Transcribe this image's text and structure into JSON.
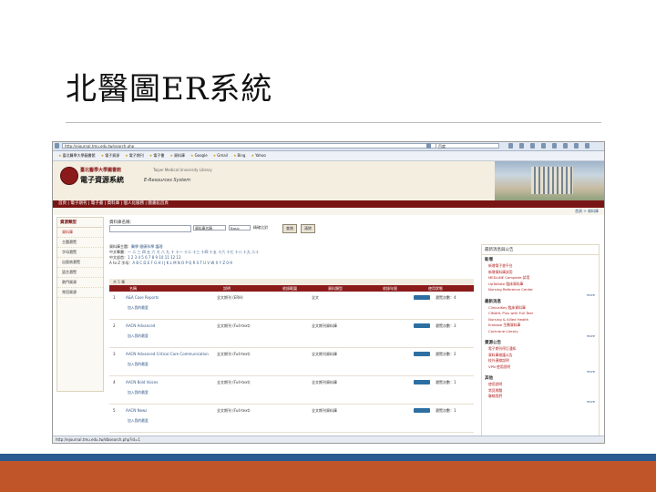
{
  "slide": {
    "title": "北醫圖ER系統"
  },
  "browser": {
    "url": "http://ejournal.tmu.edu.tw/search.php",
    "search_placeholder": "百度"
  },
  "favorites": [
    "臺北醫學大學圖書館",
    "電子資源",
    "電子期刊",
    "電子書",
    "資料庫",
    "Google",
    "Gmail",
    "Bing",
    "Yahoo"
  ],
  "header": {
    "university": "臺北醫學大學圖書館",
    "university_en": "Taipei Medical University Library",
    "system_name": "電子資源系統",
    "system_en": "E-Resources System",
    "toplinks": "首頁 | 電子資源系統 | 圖書館"
  },
  "nav": {
    "text": "首頁 | 電子期刊 | 電子書 | 資料庫 | 個人化服務 | 圖書館首頁"
  },
  "breadcrumb": "首頁 > 資料庫",
  "sidebar": {
    "heading": "資源類型",
    "items": [
      "資料庫",
      "主題瀏覽",
      "字母瀏覽",
      "出版商瀏覽",
      "語言瀏覽",
      "熱門資源",
      "常用資源"
    ]
  },
  "search": {
    "label": "資料庫名稱：",
    "field_select": "資料庫名稱",
    "type_select": "Basic",
    "option_label": "精確比對",
    "search_button": "查詢",
    "reset_button": "清除"
  },
  "filters": {
    "line1_label": "資料庫主題：",
    "line1_value": "醫學 健康科學 護理",
    "line2_label": "中文筆畫：",
    "line2_value": "一 二 三 四 五 六 七 八 九 十 十一 十二 十三 十四 十五 十六 十七 十八 十九 二十",
    "line3_label": "中文部首：",
    "line3_value": "1 2 3 4 5 6 7 8 9 10 11 12 13",
    "line4_label": "A to Z 字母：",
    "line4_value": "A B C D E F G H I J K L M N O P Q R S T U V W X Y Z 0-9"
  },
  "table": {
    "toolbar": "共 5 筆",
    "headers": [
      "名稱",
      "說明",
      "收錄範圍",
      "資料類型",
      "收錄年限",
      "使用狀態"
    ],
    "rows": [
      {
        "num": "1",
        "title": "A&A Case Reports",
        "desc": "全文期刊 (ERH)",
        "type": "全文",
        "stats": "瀏覽次數：4",
        "tag": "加入我的最愛"
      },
      {
        "num": "2",
        "title": "AACN Advanced",
        "desc": "全文期刊 (Full-text)",
        "type": "全文期刊資料庫",
        "stats": "瀏覽次數：3",
        "tag": "加入我的最愛"
      },
      {
        "num": "3",
        "title": "AACN Advanced Critical Care Communication",
        "desc": "全文期刊 (Full-text)",
        "type": "全文期刊資料庫",
        "stats": "瀏覽次數：2",
        "tag": "加入我的最愛"
      },
      {
        "num": "4",
        "title": "AACN Bold Voices",
        "desc": "全文期刊 (Full-text)",
        "type": "全文期刊資料庫",
        "stats": "瀏覽次數：1",
        "tag": "加入我的最愛"
      },
      {
        "num": "5",
        "title": "AACN News",
        "desc": "全文期刊 (Full-text)",
        "type": "全文期刊資料庫",
        "stats": "瀏覽次數：1",
        "tag": "加入我的最愛"
      }
    ]
  },
  "right_panel": {
    "heading": "最新消息與公告",
    "sections": [
      {
        "title": "新增",
        "items": [
          "新增電子書平台",
          "新增資料庫試用",
          "MEDLINE Complete 試用",
          "UpToDate 臨床資料庫",
          "Nursing Reference Center"
        ]
      },
      {
        "title": "最新消息",
        "items": [
          "ClinicalKey 臨床資料庫",
          "CINAHL Plus with Full Text",
          "Nursing & Allied Health",
          "Embase 生醫資料庫",
          "Cochrane Library"
        ]
      },
      {
        "title": "資源公告",
        "items": [
          "電子期刊停訂通知",
          "資料庫維護公告",
          "校外連線說明",
          "VPN 使用說明"
        ]
      },
      {
        "title": "其他",
        "items": [
          "使用說明",
          "常見問題",
          "聯絡我們"
        ]
      }
    ],
    "more": "more"
  },
  "status_bar": "http://ejournal.tmu.edu.tw/dbsearch.php?id=1"
}
